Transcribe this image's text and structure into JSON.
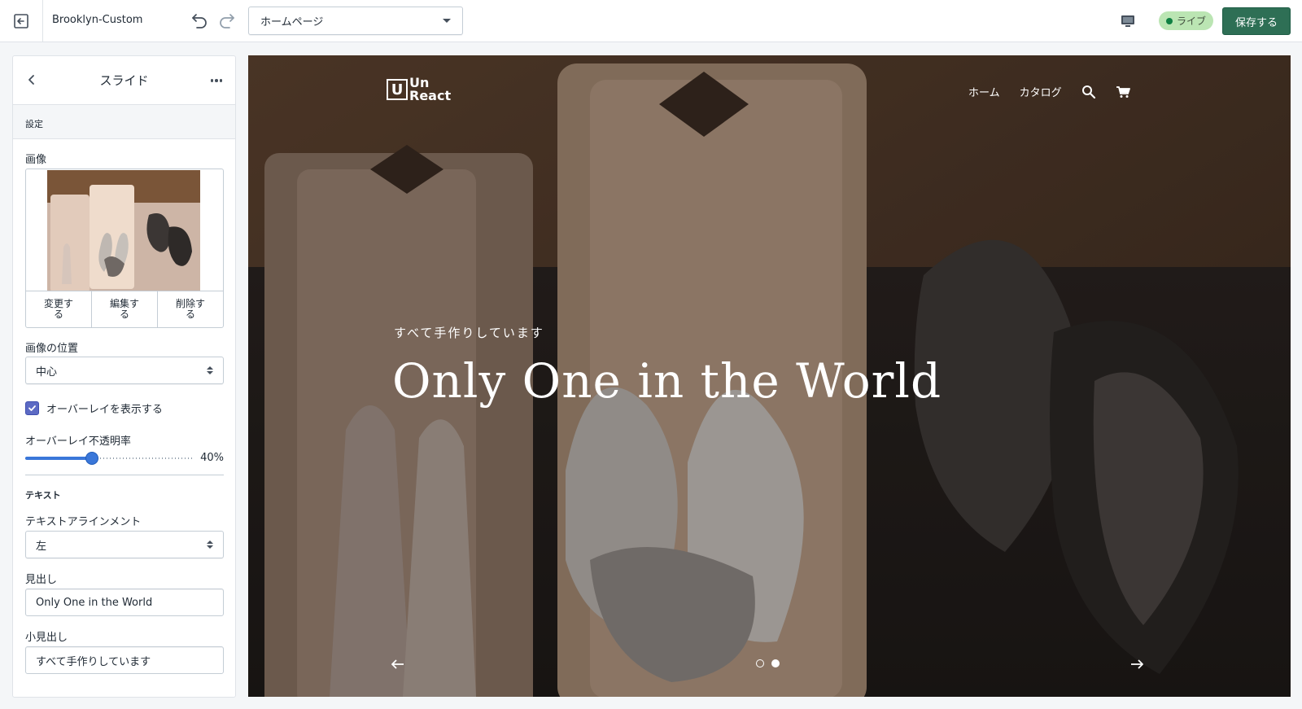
{
  "topbar": {
    "exit_icon": "exit-icon",
    "theme_name": "Brooklyn-Custom",
    "page_select_value": "ホームページ",
    "live_label": "ライブ",
    "save_label": "保存する"
  },
  "sidebar": {
    "title": "スライド",
    "section_label": "設定",
    "image_label": "画像",
    "image_actions": {
      "change": "変更する",
      "edit": "編集する",
      "delete": "削除する"
    },
    "image_position_label": "画像の位置",
    "image_position_value": "中心",
    "overlay_checkbox_label": "オーバーレイを表示する",
    "overlay_checked": true,
    "overlay_opacity_label": "オーバーレイ不透明率",
    "overlay_opacity_value": "40%",
    "overlay_opacity_fraction": 0.4,
    "text_section_label": "テキスト",
    "text_alignment_label": "テキストアラインメント",
    "text_alignment_value": "左",
    "heading_label": "見出し",
    "heading_value": "Only One in the World",
    "subheading_label": "小見出し",
    "subheading_value": "すべて手作りしています"
  },
  "preview": {
    "logo_letter": "U",
    "logo_line1": "Un",
    "logo_line2": "React",
    "nav": [
      "ホーム",
      "カタログ"
    ],
    "hero_subheading": "すべて手作りしています",
    "hero_heading": "Only One in the World",
    "slide_count": 2,
    "active_slide": 2
  },
  "colors": {
    "save_button": "#2e6f55",
    "live_badge": "#bbe5b3",
    "checkbox": "#5c6ac4",
    "slider": "#3a77d9"
  }
}
